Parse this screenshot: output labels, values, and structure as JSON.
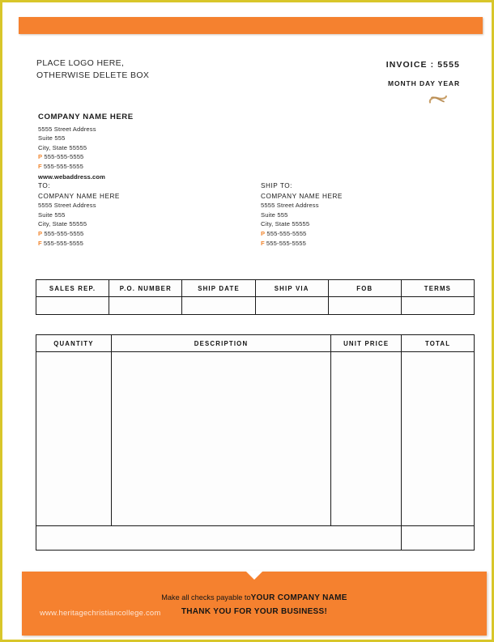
{
  "document": {
    "type": "invoice-template",
    "border_color": "#d8c62a",
    "accent_color": "#f5812f"
  },
  "header": {
    "logo_line1": "PLACE LOGO HERE,",
    "logo_line2": "OTHERWISE DELETE BOX",
    "invoice_number_label": "INVOICE : 5555",
    "date_label": "MONTH DAY YEAR",
    "flourish_icon": "swirl-ornament-icon"
  },
  "company": {
    "name": "COMPANY NAME HERE",
    "street": "5555 Street Address",
    "suite": "Suite 555",
    "city_state_zip": "City, State 55555",
    "phone_prefix": "P",
    "phone": "555-555-5555",
    "fax_prefix": "F",
    "fax": "555-555-5555",
    "website": "www.webaddress.com"
  },
  "bill_to": {
    "label": "TO:",
    "name": "COMPANY NAME HERE",
    "street": "5555 Street Address",
    "suite": "Suite 555",
    "city_state_zip": "City, State 55555",
    "phone_prefix": "P",
    "phone": "555-555-5555",
    "fax_prefix": "F",
    "fax": "555-555-5555"
  },
  "ship_to": {
    "label": "SHIP TO:",
    "name": "COMPANY NAME HERE",
    "street": "5555 Street Address",
    "suite": "Suite 555",
    "city_state_zip": "City, State 55555",
    "phone_prefix": "P",
    "phone": "555-555-5555",
    "fax_prefix": "F",
    "fax": "555-555-5555"
  },
  "sales_rep_table": {
    "headers": [
      "SALES REP.",
      "P.O. NUMBER",
      "SHIP DATE",
      "SHIP VIA",
      "FOB",
      "TERMS"
    ],
    "row": [
      "",
      "",
      "",
      "",
      "",
      ""
    ]
  },
  "items_table": {
    "headers": [
      "QUANTITY",
      "DESCRIPTION",
      "UNIT PRICE",
      "TOTAL"
    ],
    "rows": [
      [
        "",
        "",
        "",
        ""
      ]
    ],
    "total_row": [
      "",
      ""
    ]
  },
  "footer": {
    "pay_prefix": "Make all checks payable to",
    "pay_company": "YOUR COMPANY NAME",
    "thanks": "THANK YOU FOR YOUR BUSINESS!",
    "watermark": "www.heritagechristiancollege.com"
  }
}
